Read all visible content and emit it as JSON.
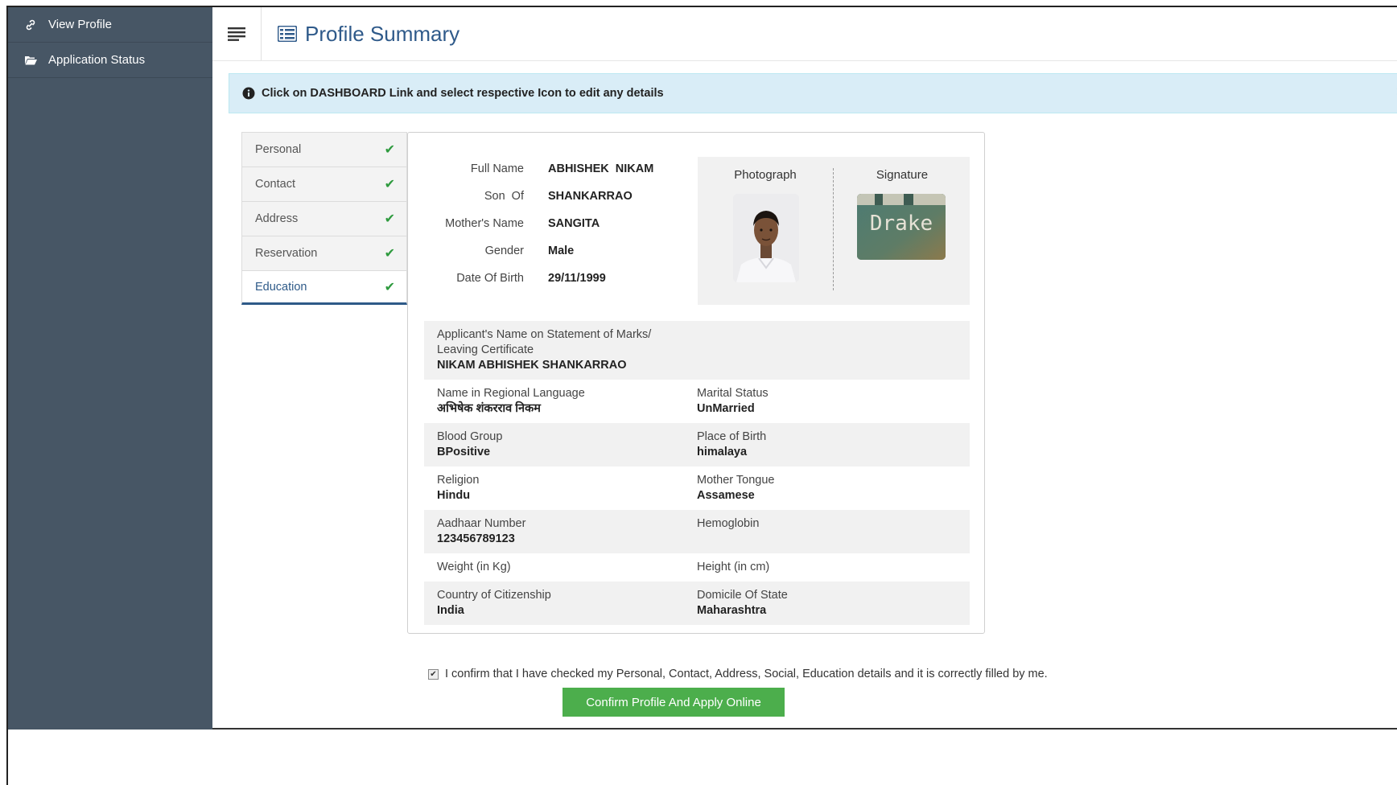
{
  "sidebar": {
    "items": [
      {
        "label": "View Profile",
        "icon": "link-icon"
      },
      {
        "label": "Application Status",
        "icon": "folder-open-icon"
      }
    ]
  },
  "header": {
    "title": "Profile Summary"
  },
  "alert": {
    "message": "Click on DASHBOARD Link and select respective Icon to edit any details",
    "close": "×"
  },
  "tabs": [
    {
      "label": "Personal"
    },
    {
      "label": "Contact"
    },
    {
      "label": "Address"
    },
    {
      "label": "Reservation"
    },
    {
      "label": "Education"
    }
  ],
  "basic": [
    {
      "label": "Full Name",
      "value": "ABHISHEK  NIKAM"
    },
    {
      "label": "Son  Of",
      "value": "SHANKARRAO"
    },
    {
      "label": "Mother's Name",
      "value": "SANGITA"
    },
    {
      "label": "Gender",
      "value": "Male"
    },
    {
      "label": "Date Of Birth",
      "value": "29/11/1999"
    }
  ],
  "media": {
    "photo_label": "Photograph",
    "signature_label": "Signature",
    "signature_text": "Drake"
  },
  "details": {
    "statement_label_1": "Applicant's Name on Statement of Marks/",
    "statement_label_2": "Leaving Certificate",
    "statement_value": "NIKAM ABHISHEK SHANKARRAO",
    "rows": [
      {
        "left_label": "Name in Regional Language",
        "left_value": "अभिषेक शंकरराव निकम",
        "right_label": "Marital Status",
        "right_value": "UnMarried"
      },
      {
        "left_label": "Blood Group",
        "left_value": "BPositive",
        "right_label": "Place of Birth",
        "right_value": "himalaya"
      },
      {
        "left_label": "Religion",
        "left_value": "Hindu",
        "right_label": "Mother Tongue",
        "right_value": "Assamese"
      },
      {
        "left_label": "Aadhaar Number",
        "left_value": "123456789123",
        "right_label": "Hemoglobin",
        "right_value": ""
      },
      {
        "left_label": "Weight (in Kg)",
        "left_value": "",
        "right_label": "Height (in cm)",
        "right_value": ""
      },
      {
        "left_label": "Country of Citizenship",
        "left_value": "India",
        "right_label": "Domicile Of State",
        "right_value": "Maharashtra"
      }
    ]
  },
  "confirm": {
    "text": "I confirm that I have checked my Personal, Contact, Address, Social, Education details and it is correctly filled by me.",
    "checked": true,
    "button": "Confirm Profile And Apply Online"
  },
  "colors": {
    "sidebar": "#475665",
    "accent": "#2e5a88",
    "success": "#4cae4c",
    "alert_bg": "#d9edf7"
  }
}
